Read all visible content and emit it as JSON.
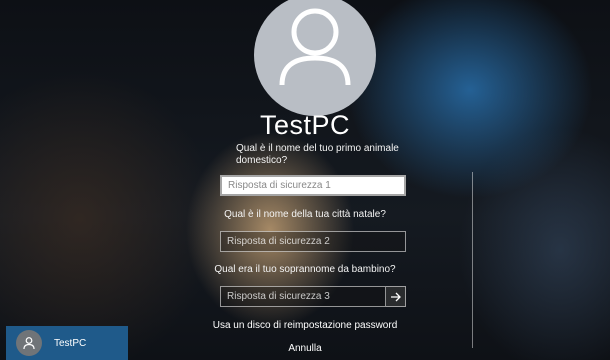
{
  "computer_name": "TestPC",
  "questions": [
    {
      "question": "Qual è il nome del tuo primo animale domestico?",
      "placeholder": "Risposta di sicurezza 1"
    },
    {
      "question": "Qual è il nome della tua città natale?",
      "placeholder": "Risposta di sicurezza 2"
    },
    {
      "question": "Qual era il tuo soprannome da bambino?",
      "placeholder": "Risposta di sicurezza 3"
    }
  ],
  "reset_disk_link": "Usa un disco di reimpostazione password",
  "cancel_link": "Annulla",
  "user_tile": {
    "name": "TestPC"
  },
  "icons": {
    "large_avatar": "user-icon",
    "submit": "arrow-right-icon",
    "small_avatar": "user-icon"
  },
  "colors": {
    "user_tile_background": "#1f5a8a",
    "avatar_background": "#b9bec5"
  }
}
